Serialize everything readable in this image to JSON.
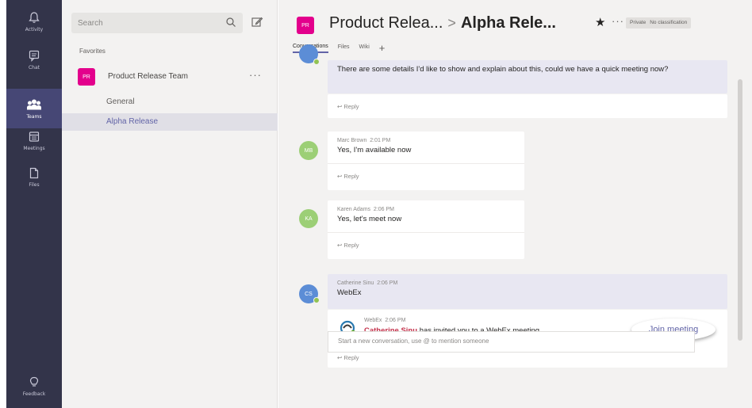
{
  "rail": {
    "items": [
      {
        "label": "Activity",
        "icon": "bell-icon"
      },
      {
        "label": "Chat",
        "icon": "chat-icon"
      },
      {
        "label": "Teams",
        "icon": "teams-icon",
        "active": true
      },
      {
        "label": "Meetings",
        "icon": "calendar-icon"
      },
      {
        "label": "Files",
        "icon": "file-icon"
      }
    ],
    "feedback_label": "Feedback"
  },
  "sidebar": {
    "search_placeholder": "Search",
    "favorites_label": "Favorites",
    "team": {
      "avatar_initials": "PR",
      "name": "Product Release Team",
      "more": "···"
    },
    "channels": [
      {
        "label": "General"
      },
      {
        "label": "Alpha Release",
        "active": true
      }
    ]
  },
  "header": {
    "avatar_initials": "PR",
    "team_title": "Product Relea...",
    "separator": ">",
    "channel_title": "Alpha Rele...",
    "star": "★",
    "more": "···",
    "badges": [
      "Private",
      "No classification"
    ],
    "tabs": [
      {
        "label": "Conversations",
        "active": true
      },
      {
        "label": "Files"
      },
      {
        "label": "Wiki"
      }
    ],
    "add_tab": "+"
  },
  "messages": [
    {
      "body": "There are some details I'd like to show and explain about this, could we have a quick meeting now?",
      "reply_label": "Reply"
    },
    {
      "avatar_initials": "MB",
      "sender": "Marc Brown",
      "time": "2:01 PM",
      "body": "Yes, I'm available now",
      "reply_label": "Reply"
    },
    {
      "avatar_initials": "KA",
      "sender": "Karen Adams",
      "time": "2:06 PM",
      "body": "Yes, let's meet now",
      "reply_label": "Reply"
    },
    {
      "avatar_initials": "CS",
      "sender": "Catherine Sinu",
      "time": "2:06 PM",
      "body": "WebEx",
      "webex": {
        "name": "WebEx",
        "time": "2:06 PM",
        "sender": "Catherine Sinu",
        "text": "has invited you to a WebEx meeting.",
        "join_label": "Join meeting"
      },
      "reply_label": "Reply"
    }
  ],
  "compose": {
    "placeholder": "Start a new conversation, use @ to mention someone"
  },
  "colors": {
    "rail_bg": "#33344a",
    "accent": "#6264a7",
    "team_avatar": "#e3008c",
    "mention": "#c4314b",
    "presence": "#92c353"
  }
}
